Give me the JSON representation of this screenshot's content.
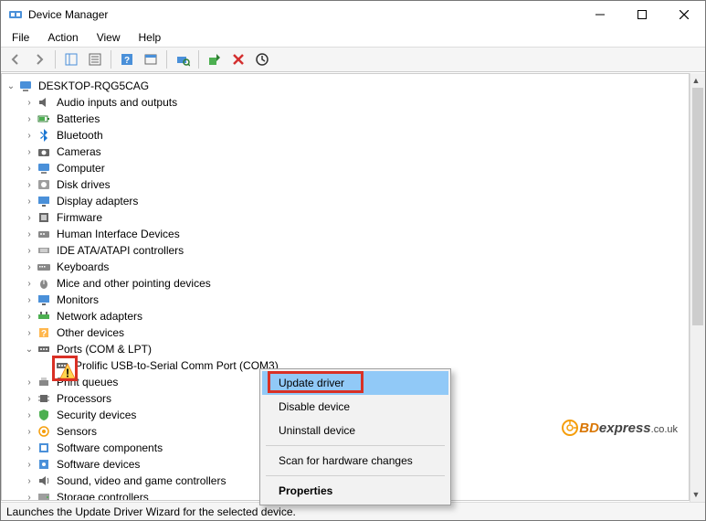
{
  "window": {
    "title": "Device Manager"
  },
  "menubar": {
    "file": "File",
    "action": "Action",
    "view": "View",
    "help": "Help"
  },
  "tree": {
    "root": "DESKTOP-RQG5CAG",
    "items": {
      "audio": "Audio inputs and outputs",
      "batteries": "Batteries",
      "bluetooth": "Bluetooth",
      "cameras": "Cameras",
      "computer": "Computer",
      "disk": "Disk drives",
      "display": "Display adapters",
      "firmware": "Firmware",
      "hid": "Human Interface Devices",
      "ide": "IDE ATA/ATAPI controllers",
      "keyboards": "Keyboards",
      "mice": "Mice and other pointing devices",
      "monitors": "Monitors",
      "network": "Network adapters",
      "other": "Other devices",
      "ports": "Ports (COM & LPT)",
      "ports_child": "Prolific USB-to-Serial Comm Port (COM3)",
      "printq": "Print queues",
      "processors": "Processors",
      "security": "Security devices",
      "sensors": "Sensors",
      "swcomp": "Software components",
      "swdev": "Software devices",
      "sound": "Sound, video and game controllers",
      "storage": "Storage controllers"
    }
  },
  "context_menu": {
    "update": "Update driver",
    "disable": "Disable device",
    "uninstall": "Uninstall device",
    "scan": "Scan for hardware changes",
    "properties": "Properties"
  },
  "statusbar": {
    "text": "Launches the Update Driver Wizard for the selected device."
  },
  "watermark": {
    "bd": "BD",
    "ex": "express",
    "uk": ".co.uk"
  }
}
